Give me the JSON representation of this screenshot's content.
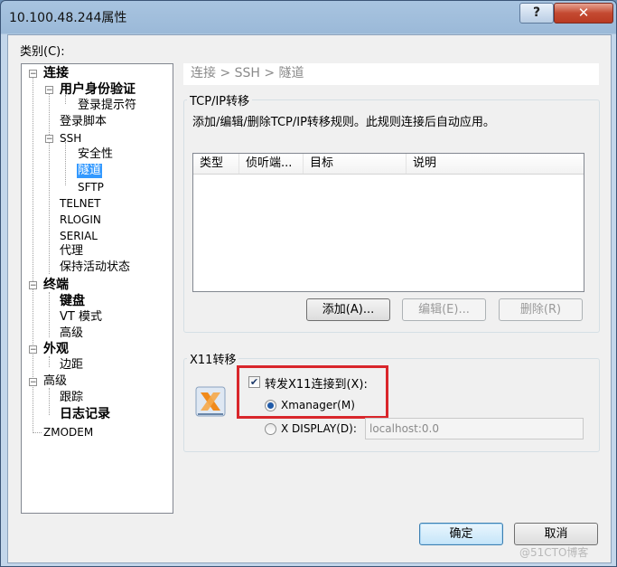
{
  "window": {
    "title": "10.100.48.244属性"
  },
  "controls": {
    "help_glyph": "?",
    "close_glyph": "✕"
  },
  "category_label": "类别(C):",
  "tree": {
    "nodes": [
      {
        "label": "连接",
        "expander": "−"
      },
      {
        "label": "用户身份验证",
        "expander": "−"
      },
      {
        "label": "登录提示符"
      },
      {
        "label": "登录脚本"
      },
      {
        "label": "SSH",
        "expander": "−"
      },
      {
        "label": "安全性"
      },
      {
        "label": "隧道",
        "selected": true
      },
      {
        "label": "SFTP"
      },
      {
        "label": "TELNET"
      },
      {
        "label": "RLOGIN"
      },
      {
        "label": "SERIAL"
      },
      {
        "label": "代理"
      },
      {
        "label": "保持活动状态"
      },
      {
        "label": "终端",
        "expander": "−"
      },
      {
        "label": "键盘"
      },
      {
        "label": "VT 模式"
      },
      {
        "label": "高级"
      },
      {
        "label": "外观",
        "expander": "−"
      },
      {
        "label": "边距"
      },
      {
        "label": "高级",
        "expander": "−"
      },
      {
        "label": "跟踪"
      },
      {
        "label": "日志记录"
      },
      {
        "label": "ZMODEM"
      }
    ]
  },
  "breadcrumb": "连接 > SSH > 隧道",
  "tcpip": {
    "group_title": "TCP/IP转移",
    "description": "添加/编辑/删除TCP/IP转移规则。此规则连接后自动应用。",
    "columns": [
      "类型",
      "侦听端...",
      "目标",
      "说明"
    ],
    "add_label": "添加(A)...",
    "edit_label": "编辑(E)...",
    "delete_label": "删除(R)"
  },
  "x11": {
    "group_title": "X11转移",
    "forward_label": "转发X11连接到(X):",
    "forward_checked": true,
    "xmanager_label": "Xmanager(M)",
    "xdisplay_label": "X DISPLAY(D):",
    "xdisplay_value": "localhost:0.0",
    "icon": "x11-logo-icon"
  },
  "footer": {
    "ok_label": "确定",
    "cancel_label": "取消"
  },
  "watermark": "@51CTO博客",
  "colors": {
    "selection": "#3399ff",
    "highlight_box": "#d9262b",
    "close_button": "#c44a31"
  }
}
